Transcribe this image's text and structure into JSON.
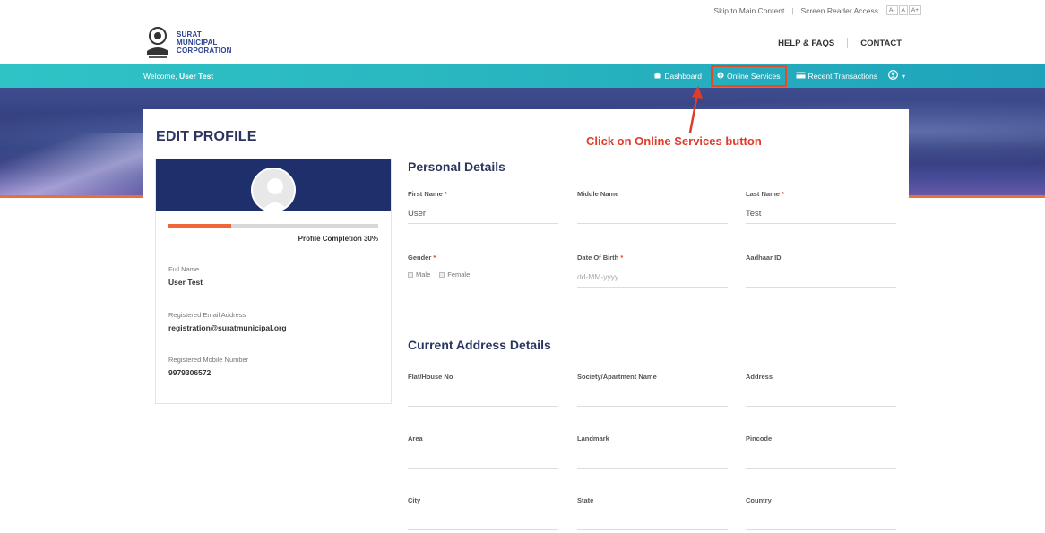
{
  "utility": {
    "skip_link": "Skip to Main Content",
    "screen_reader": "Screen Reader Access",
    "font_sizes": [
      "A-",
      "A",
      "A+"
    ]
  },
  "logo": {
    "line1": "SURAT",
    "line2": "MUNICIPAL",
    "line3": "CORPORATION"
  },
  "header": {
    "help": "HELP & FAQS",
    "contact": "CONTACT"
  },
  "navbar": {
    "welcome_prefix": "Welcome,",
    "username": "User Test",
    "items": [
      {
        "icon": "dashboard-icon",
        "label": "Dashboard"
      },
      {
        "icon": "globe-icon",
        "label": "Online Services"
      },
      {
        "icon": "card-icon",
        "label": "Recent Transactions"
      }
    ],
    "user_icon": "user-icon",
    "caret": "▾"
  },
  "page": {
    "title": "EDIT PROFILE",
    "annotation": "Click on Online Services button",
    "annotation_color": "#e03b2a"
  },
  "profile": {
    "completion_label": "Profile Completion 30%",
    "completion_fraction": 0.3,
    "full_name_label": "Full Name",
    "full_name": "User Test",
    "email_label": "Registered Email Address",
    "email": "registration@suratmunicipal.org",
    "mobile_label": "Registered Mobile Number",
    "mobile": "9979306572"
  },
  "personal": {
    "title": "Personal Details",
    "first_name_label": "First Name",
    "first_name": "User",
    "middle_name_label": "Middle Name",
    "middle_name": "",
    "last_name_label": "Last Name",
    "last_name": "Test",
    "gender_label": "Gender",
    "gender_options": [
      "Male",
      "Female"
    ],
    "dob_label": "Date Of Birth",
    "dob_placeholder": "dd-MM-yyyy",
    "aadhaar_label": "Aadhaar ID",
    "required_mark": "*"
  },
  "address": {
    "title": "Current Address Details",
    "flat_label": "Flat/House No",
    "society_label": "Society/Apartment Name",
    "address_label": "Address",
    "area_label": "Area",
    "landmark_label": "Landmark",
    "pincode_label": "Pincode",
    "city_label": "City",
    "state_label": "State",
    "country_label": "Country"
  }
}
